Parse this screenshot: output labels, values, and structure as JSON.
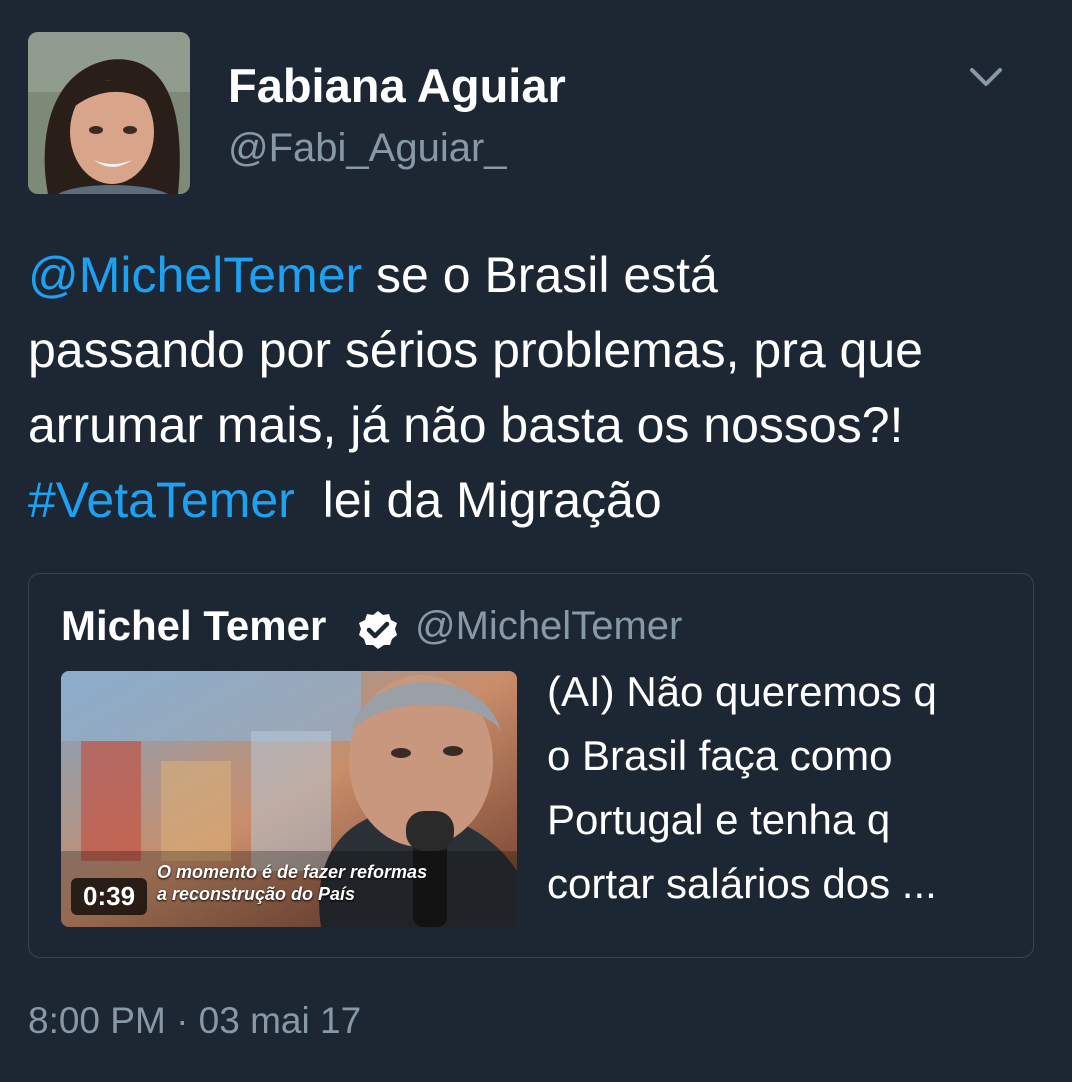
{
  "author": {
    "display_name": "Fabiana Aguiar",
    "handle": "@Fabi_Aguiar_"
  },
  "tweet": {
    "mention": "@MichelTemer",
    "line1_rest": " se o Brasil está",
    "line2": "passando por sérios problemas, pra que",
    "line3": "arrumar mais, já não basta os nossos?!",
    "hashtag": "#VetaTemer",
    "line4_rest": "  lei da Migração"
  },
  "quoted_tweet": {
    "display_name": "Michel Temer",
    "handle": "@MichelTemer",
    "verified": true,
    "video_duration": "0:39",
    "video_caption_line1": "O momento é de fazer reformas",
    "video_caption_line2": "a reconstrução do País",
    "text_lines": [
      "(AI) Não queremos q",
      "o Brasil faça como",
      "Portugal e tenha q",
      "cortar salários dos ..."
    ]
  },
  "timestamp": "8:00 PM · 03 mai 17",
  "icons": {
    "menu": "chevron-down-icon",
    "verified": "verified-badge-icon"
  },
  "colors": {
    "background": "#1c2733",
    "link": "#1da1f2",
    "secondary_text": "#8899a6",
    "border": "#38444d"
  }
}
